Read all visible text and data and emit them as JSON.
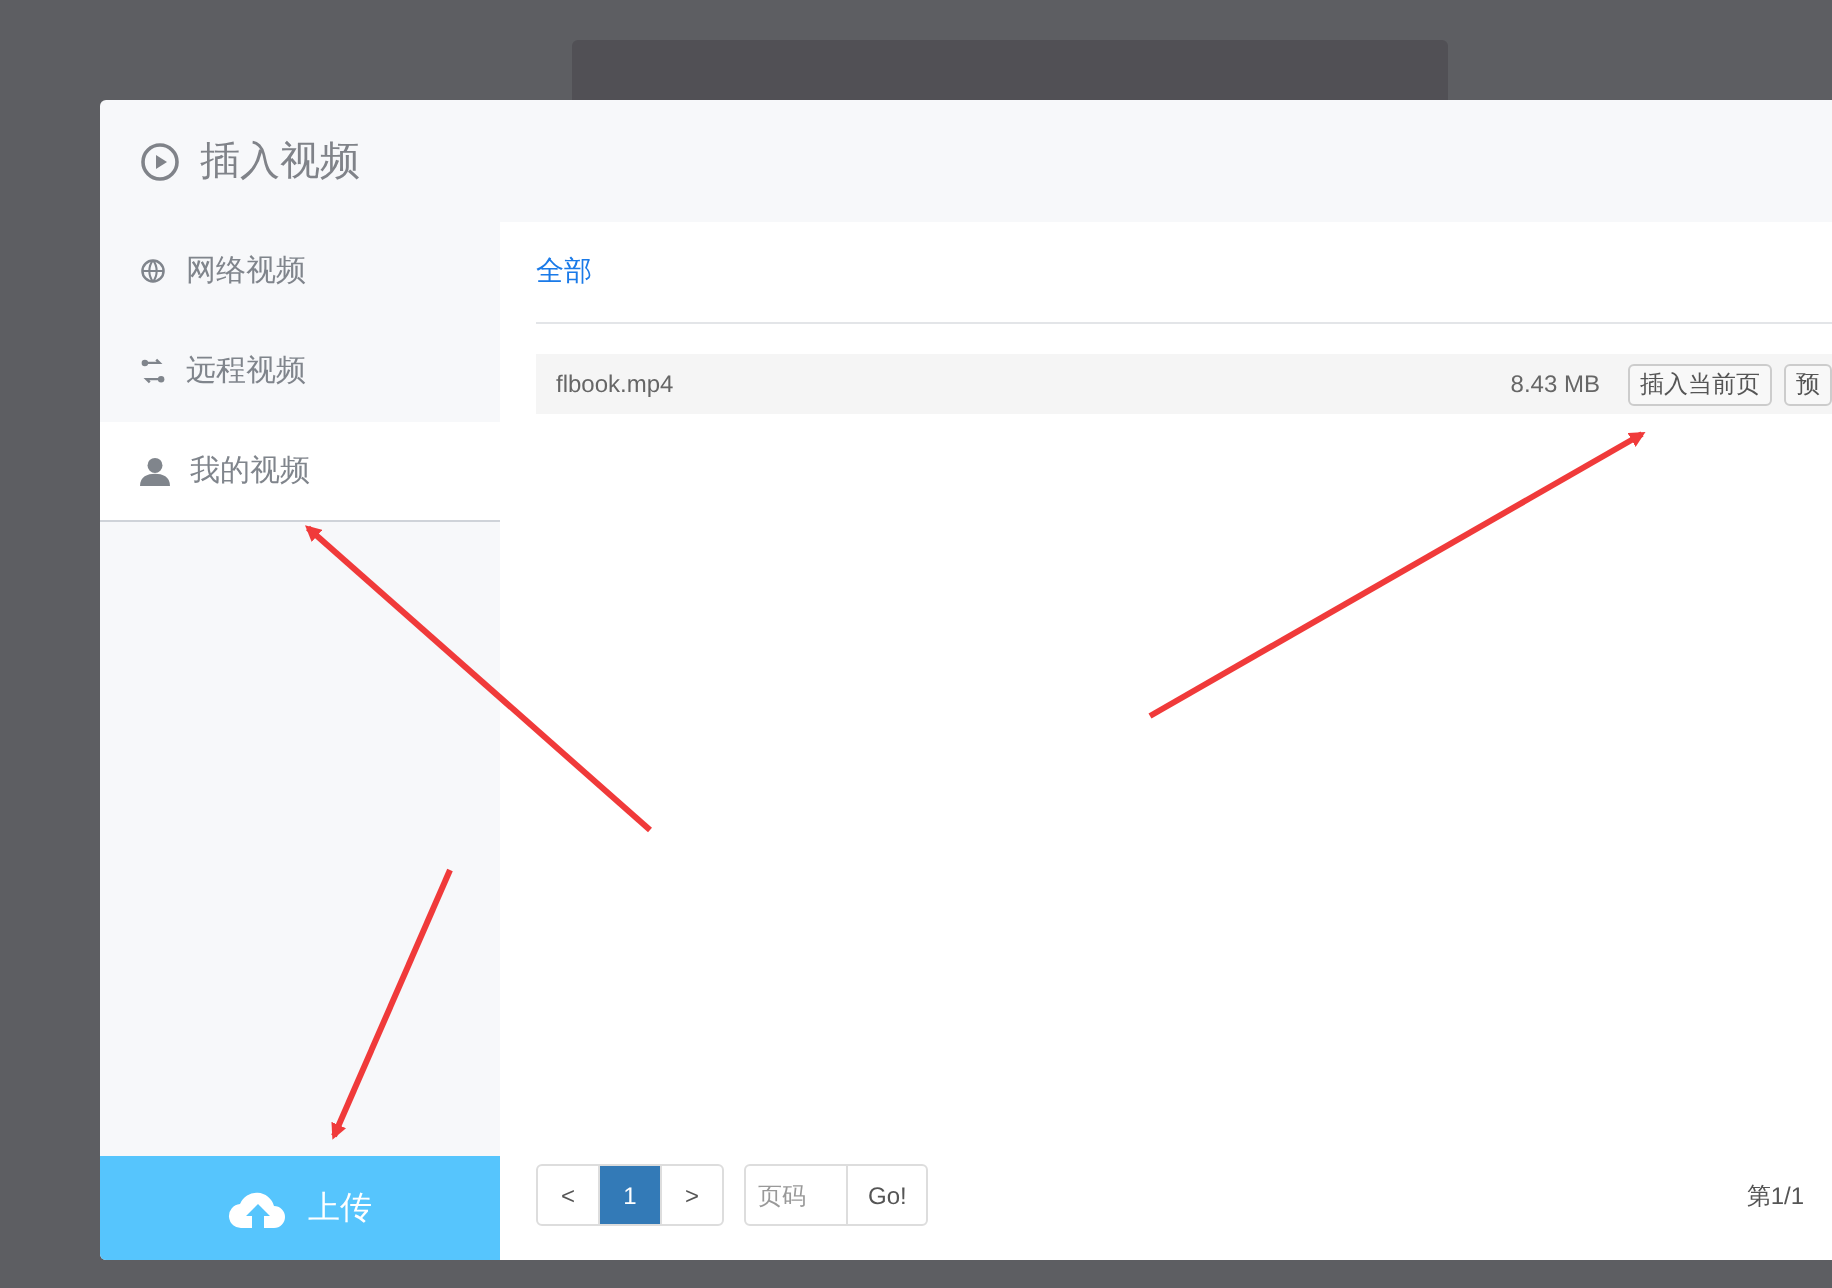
{
  "dialog": {
    "title": "插入视频"
  },
  "sidebar": {
    "items": [
      {
        "label": "网络视频",
        "kind": "globe",
        "selected": false
      },
      {
        "label": "远程视频",
        "kind": "remote",
        "selected": false
      },
      {
        "label": "我的视频",
        "kind": "user",
        "selected": true
      }
    ],
    "upload_button": "上传"
  },
  "filter_tabs": [
    {
      "label": "全部",
      "selected": true
    }
  ],
  "files": [
    {
      "name": "flbook.mp4",
      "size": "8.43 MB",
      "actions": [
        "插入当前页",
        "预"
      ]
    }
  ],
  "pagination": {
    "prev": "<",
    "pages": [
      {
        "label": "1",
        "selected": true
      }
    ],
    "next": ">",
    "page_input": {
      "placeholder": "页码"
    },
    "go": "Go!",
    "summary": "第1/1"
  }
}
